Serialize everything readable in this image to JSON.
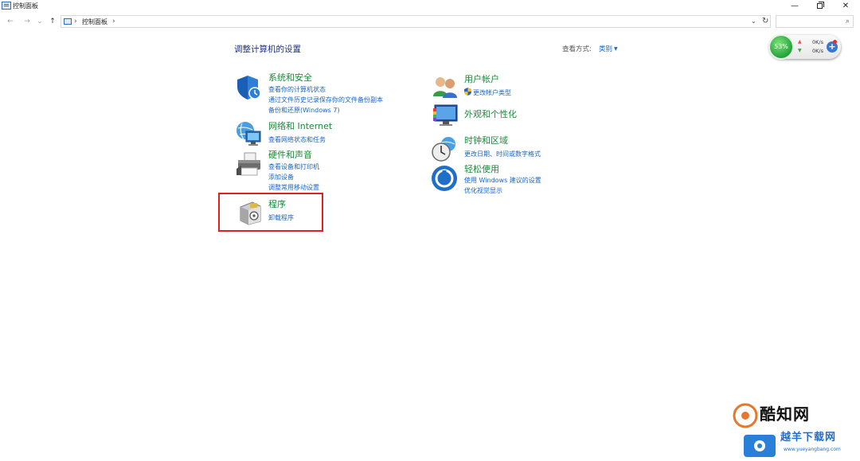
{
  "window": {
    "title": "控制面板",
    "minimize_icon": "minimize-icon",
    "maximize_icon": "restore-icon",
    "close_icon": "close-icon"
  },
  "address_bar": {
    "back_icon": "←",
    "forward_icon": "→",
    "recent_icon": "⌄",
    "up_icon": "↑",
    "breadcrumb_sep": "›",
    "breadcrumb": "控制面板",
    "trailing_sep": "›",
    "dropdown_icon": "⌄",
    "refresh_icon": "↻",
    "search_placeholder": "",
    "search_icon": "⌕"
  },
  "main": {
    "title": "调整计算机的设置",
    "view_label": "查看方式:",
    "view_value": "类别",
    "view_arrow": "▼"
  },
  "categories": {
    "system": {
      "title": "系统和安全",
      "links": [
        "查看你的计算机状态",
        "通过文件历史记录保存你的文件备份副本",
        "备份和还原(Windows 7)"
      ],
      "icon": "shield-icon"
    },
    "network": {
      "title": "网络和 Internet",
      "links": [
        "查看网络状态和任务"
      ],
      "icon": "globe-network-icon"
    },
    "hardware": {
      "title": "硬件和声音",
      "links": [
        "查看设备和打印机",
        "添加设备",
        "调整常用移动设置"
      ],
      "icon": "printer-icon"
    },
    "programs": {
      "title": "程序",
      "links": [
        "卸载程序"
      ],
      "icon": "programs-box-icon"
    },
    "users": {
      "title": "用户帐户",
      "links": [
        "更改帐户类型"
      ],
      "icon": "users-icon",
      "link_icon": "uac-shield-icon"
    },
    "appearance": {
      "title": "外观和个性化",
      "links": [],
      "icon": "monitor-palette-icon"
    },
    "clock": {
      "title": "时钟和区域",
      "links": [
        "更改日期、时间或数字格式"
      ],
      "icon": "clock-globe-icon"
    },
    "ease": {
      "title": "轻松使用",
      "links": [
        "使用 Windows 建议的设置",
        "优化视觉显示"
      ],
      "icon": "ease-of-access-icon"
    }
  },
  "net_widget": {
    "percent": "53%",
    "up_speed": "0K/s",
    "down_speed": "0K/s",
    "up_arrow": "▲",
    "down_arrow": "▼",
    "plus": "+",
    "colors": {
      "gauge": "#23a33a",
      "plus": "#3a78d0"
    }
  },
  "watermarks": {
    "text1": "酷知网",
    "text2": "越羊下载网",
    "url": "www.yueyangbang.com"
  },
  "colors": {
    "title_blue": "#1e3287",
    "category_green": "#1a8a3a",
    "link_blue": "#1a66c2",
    "highlight_red": "#e02020"
  }
}
